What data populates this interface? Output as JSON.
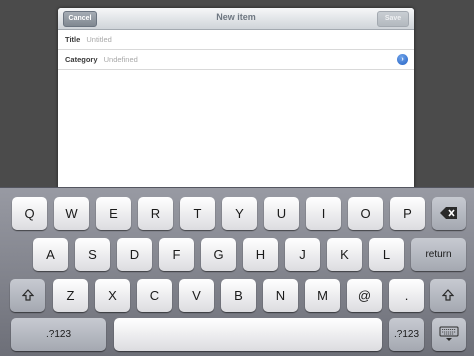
{
  "sheet": {
    "title": "New item",
    "cancel_label": "Cancel",
    "save_label": "Save",
    "rows": [
      {
        "label": "Title",
        "value": "Untitled"
      },
      {
        "label": "Category",
        "value": "Undefined",
        "accessory": "disclosure-icon"
      }
    ]
  },
  "keyboard": {
    "row1": [
      "Q",
      "W",
      "E",
      "R",
      "T",
      "Y",
      "U",
      "I",
      "O",
      "P"
    ],
    "row2": [
      "A",
      "S",
      "D",
      "F",
      "G",
      "H",
      "J",
      "K",
      "L"
    ],
    "row3": [
      "Z",
      "X",
      "C",
      "V",
      "B",
      "N",
      "M",
      "@",
      "."
    ],
    "return_label": "return",
    "numbers_label": ".?123",
    "backspace_icon": "backspace-icon",
    "shift_icon": "shift-icon",
    "hide_icon": "keyboard-hide-icon"
  }
}
